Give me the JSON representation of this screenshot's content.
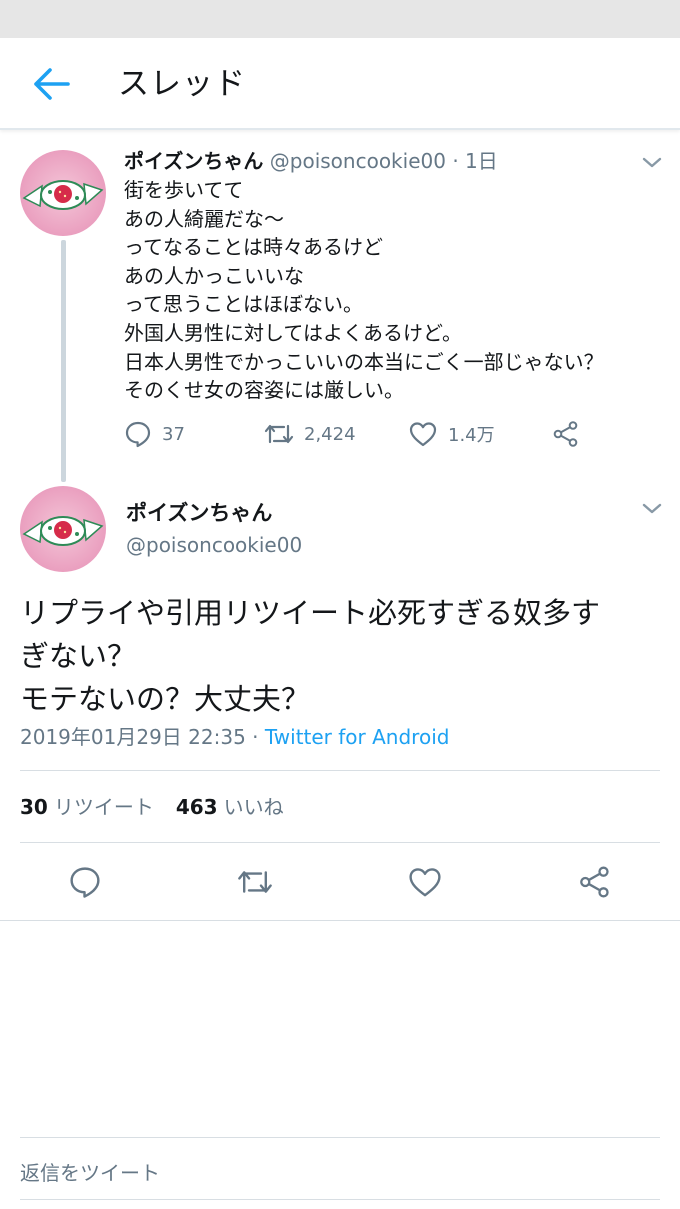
{
  "app": {
    "title": "スレッド",
    "icons": {
      "back": "arrow-left-icon",
      "caret": "chevron-down-icon"
    },
    "colors": {
      "accent": "#1da1f2",
      "text": "#14171a",
      "muted": "#657786",
      "divider": "#e1e8ed"
    }
  },
  "parent_tweet": {
    "name": "ポイズンちゃん",
    "handle": "@poisoncookie00",
    "time": "· 1日",
    "lines": [
      "街を歩いてて",
      "あの人綺麗だな〜",
      "ってなることは時々あるけど",
      "あの人かっこいいな",
      "って思うことはほぼない。",
      "外国人男性に対してはよくあるけど。",
      "日本人男性でかっこいいの本当にごく一部じゃない？",
      "そのくせ女の容姿には厳しい。"
    ],
    "reply_count": "37",
    "retweet_count": "2,424",
    "like_count": "1.4万"
  },
  "main_tweet": {
    "name": "ポイズンちゃん",
    "handle": "@poisoncookie00",
    "lines": [
      "リプライや引用リツイート必死すぎる奴多す",
      "ぎない？",
      "モテないの？大丈夫？"
    ],
    "timestamp": "2019年01月29日 22:35 · ",
    "source": "Twitter for Android",
    "retweets": "30",
    "retweets_label": "リツイート",
    "likes": "463",
    "likes_label": "いいね"
  },
  "reply": {
    "placeholder": "返信をツイート"
  }
}
